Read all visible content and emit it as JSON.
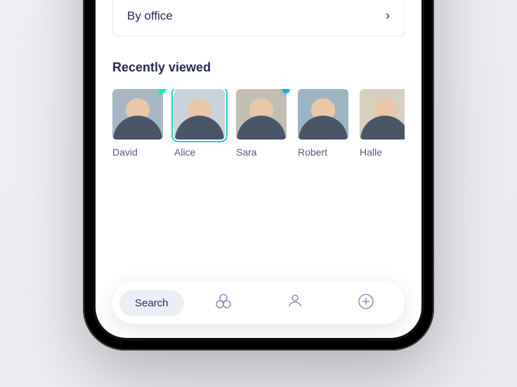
{
  "filter": {
    "by_office_label": "By office"
  },
  "recently_viewed": {
    "title": "Recently viewed",
    "people": [
      {
        "name": "David",
        "status": "green",
        "selected": false,
        "bg": "bg-steel"
      },
      {
        "name": "Alice",
        "status": null,
        "selected": true,
        "bg": "bg-grey"
      },
      {
        "name": "Sara",
        "status": "blue",
        "selected": false,
        "bg": "bg-taupe"
      },
      {
        "name": "Robert",
        "status": null,
        "selected": false,
        "bg": "bg-cool"
      },
      {
        "name": "Halle",
        "status": null,
        "selected": false,
        "bg": "bg-cream"
      }
    ]
  },
  "tabs": {
    "search_label": "Search",
    "icons": [
      "circles-icon",
      "person-pin-icon",
      "plus-icon"
    ]
  },
  "colors": {
    "text_primary": "#272a5a",
    "accent": "#20d4c4"
  }
}
